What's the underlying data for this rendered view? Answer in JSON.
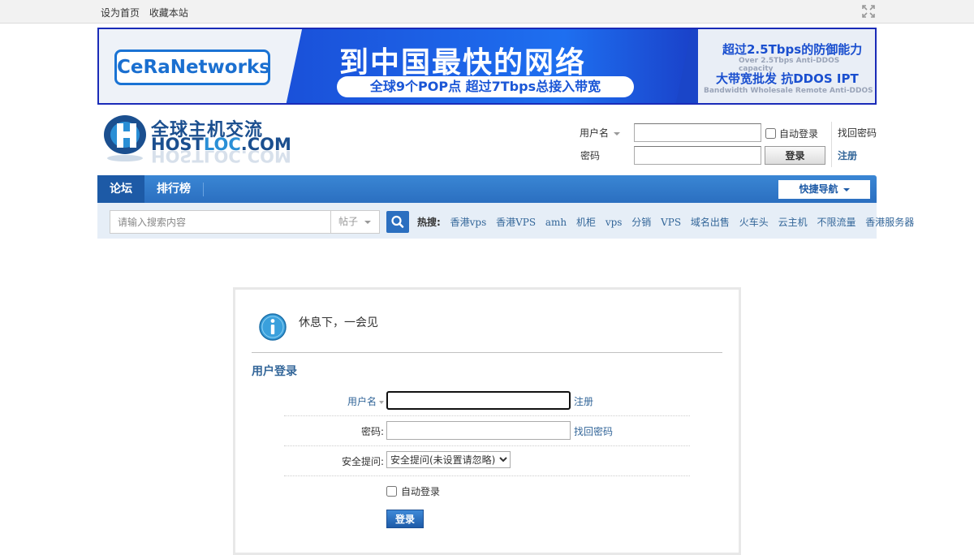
{
  "topbar": {
    "set_home": "设为首页",
    "bookmark": "收藏本站",
    "expand_icon": "expand-icon"
  },
  "banner": {
    "brand": "CeRaNetworks",
    "headline": "到中国最快的网络",
    "subline": "全球9个POP点  超过7Tbps总接入带宽",
    "right_line1": "超过2.5Tbps的防御能力",
    "right_line1_small": "Over 2.5Tbps Anti-DDOS capacity",
    "right_line2": "大带宽批发  抗DDOS IPT",
    "right_line2_small": "Bandwidth Wholesale  Remote Anti-DDOS"
  },
  "site": {
    "logo_cn": "全球主机交流",
    "logo_en_a": "HOST",
    "logo_en_b": "LOC",
    "logo_en_c": ".COM"
  },
  "header_login": {
    "username_label": "用户名",
    "password_label": "密码",
    "auto_login": "自动登录",
    "login_button": "登录",
    "find_password": "找回密码",
    "register": "注册"
  },
  "nav": {
    "tabs": [
      {
        "label": "论坛",
        "active": true
      },
      {
        "label": "排行榜",
        "active": false
      }
    ],
    "quick_nav": "快捷导航"
  },
  "search": {
    "placeholder": "请输入搜索内容",
    "type": "帖子",
    "hot_label": "热搜:",
    "hot_terms": [
      "香港vps",
      "香港VPS",
      "amh",
      "机柜",
      "vps",
      "分销",
      "VPS",
      "域名出售",
      "火车头",
      "云主机",
      "不限流量",
      "香港服务器"
    ]
  },
  "panel": {
    "message": "休息下，一会见",
    "title": "用户登录",
    "username_label": "用户名",
    "register": "注册",
    "password_label": "密码:",
    "find_password": "找回密码",
    "question_label": "安全提问:",
    "question_selected": "安全提问(未设置请忽略)",
    "auto_login": "自动登录",
    "submit": "登录"
  },
  "colors": {
    "nav_blue": "#2b6fc0",
    "link_blue": "#336699",
    "banner_blue": "#1a4fd8"
  }
}
